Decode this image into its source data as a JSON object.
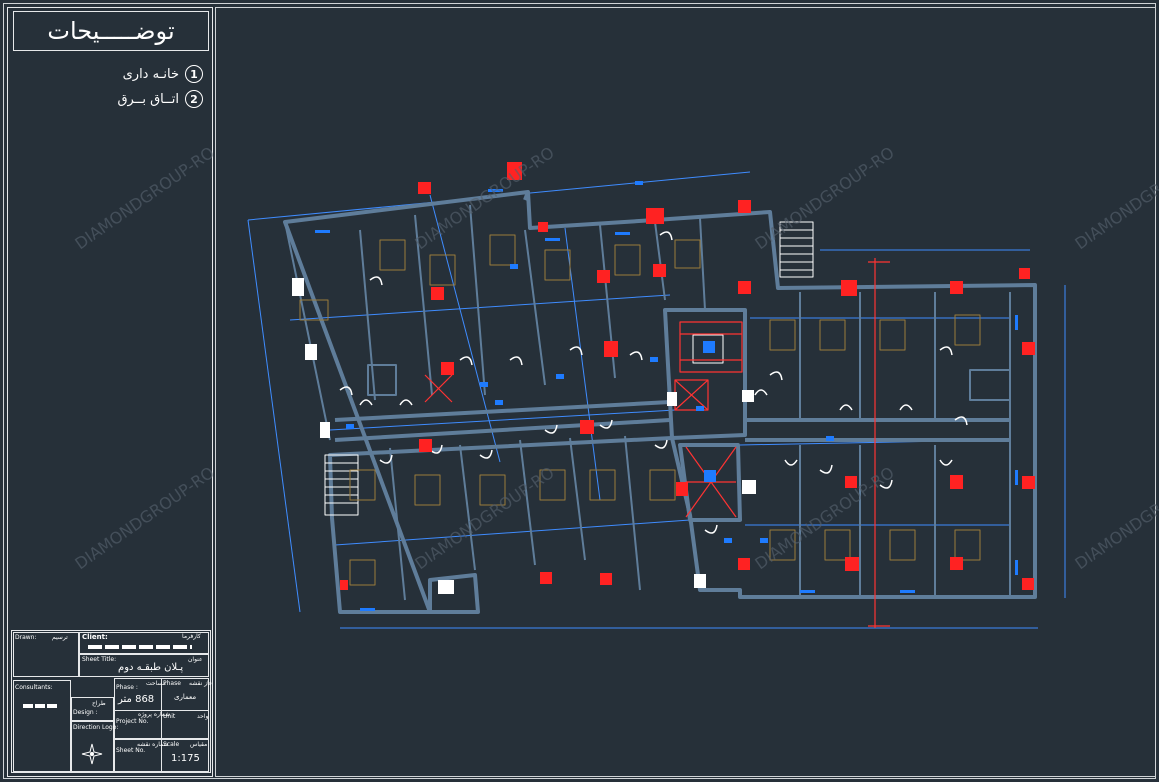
{
  "legend": {
    "title": "توضـــــیحات",
    "items": [
      {
        "num": "1",
        "label": "خانـه داری"
      },
      {
        "num": "2",
        "label": "اتــاق بــرق"
      }
    ]
  },
  "title_block": {
    "drawn_label": "Drawn:",
    "drawn_fa": "ترسیم",
    "client_label": "Client:",
    "client_fa": "کارفرما",
    "sheet_title_label": "Sheet Title:",
    "sheet_title_fa": "عنوان",
    "sheet_title_value": "پـلان طبقـه دوم",
    "consultants_label": "Consultants:",
    "designer_label": "Design :",
    "designer_fa": "طراح",
    "direction_label": "Direction Logo:",
    "phase_label": "Phase :",
    "phase_fa": "مساحت",
    "area_value": "868 متر",
    "phase2_label": "Phase",
    "phase2_fa": "فاز نقشه",
    "phase2_value": "معماری",
    "project_label": "Project No.",
    "project_fa": "شماره پروژه",
    "unit_label": "Unit",
    "unit_fa": "واحد",
    "sheet_no_label": "Sheet No.",
    "sheet_no_fa": "شماره نقشه",
    "scale_label": "Scale",
    "scale_fa": "مقیاس",
    "scale_value": "1:175"
  },
  "watermark": "DIAMONDGROUP-RO",
  "colors": {
    "background": "#263039",
    "wall": "#5f7d9a",
    "dim": "#3f8cff",
    "marker": "#ff2222",
    "furniture": "#9a7b3c"
  }
}
